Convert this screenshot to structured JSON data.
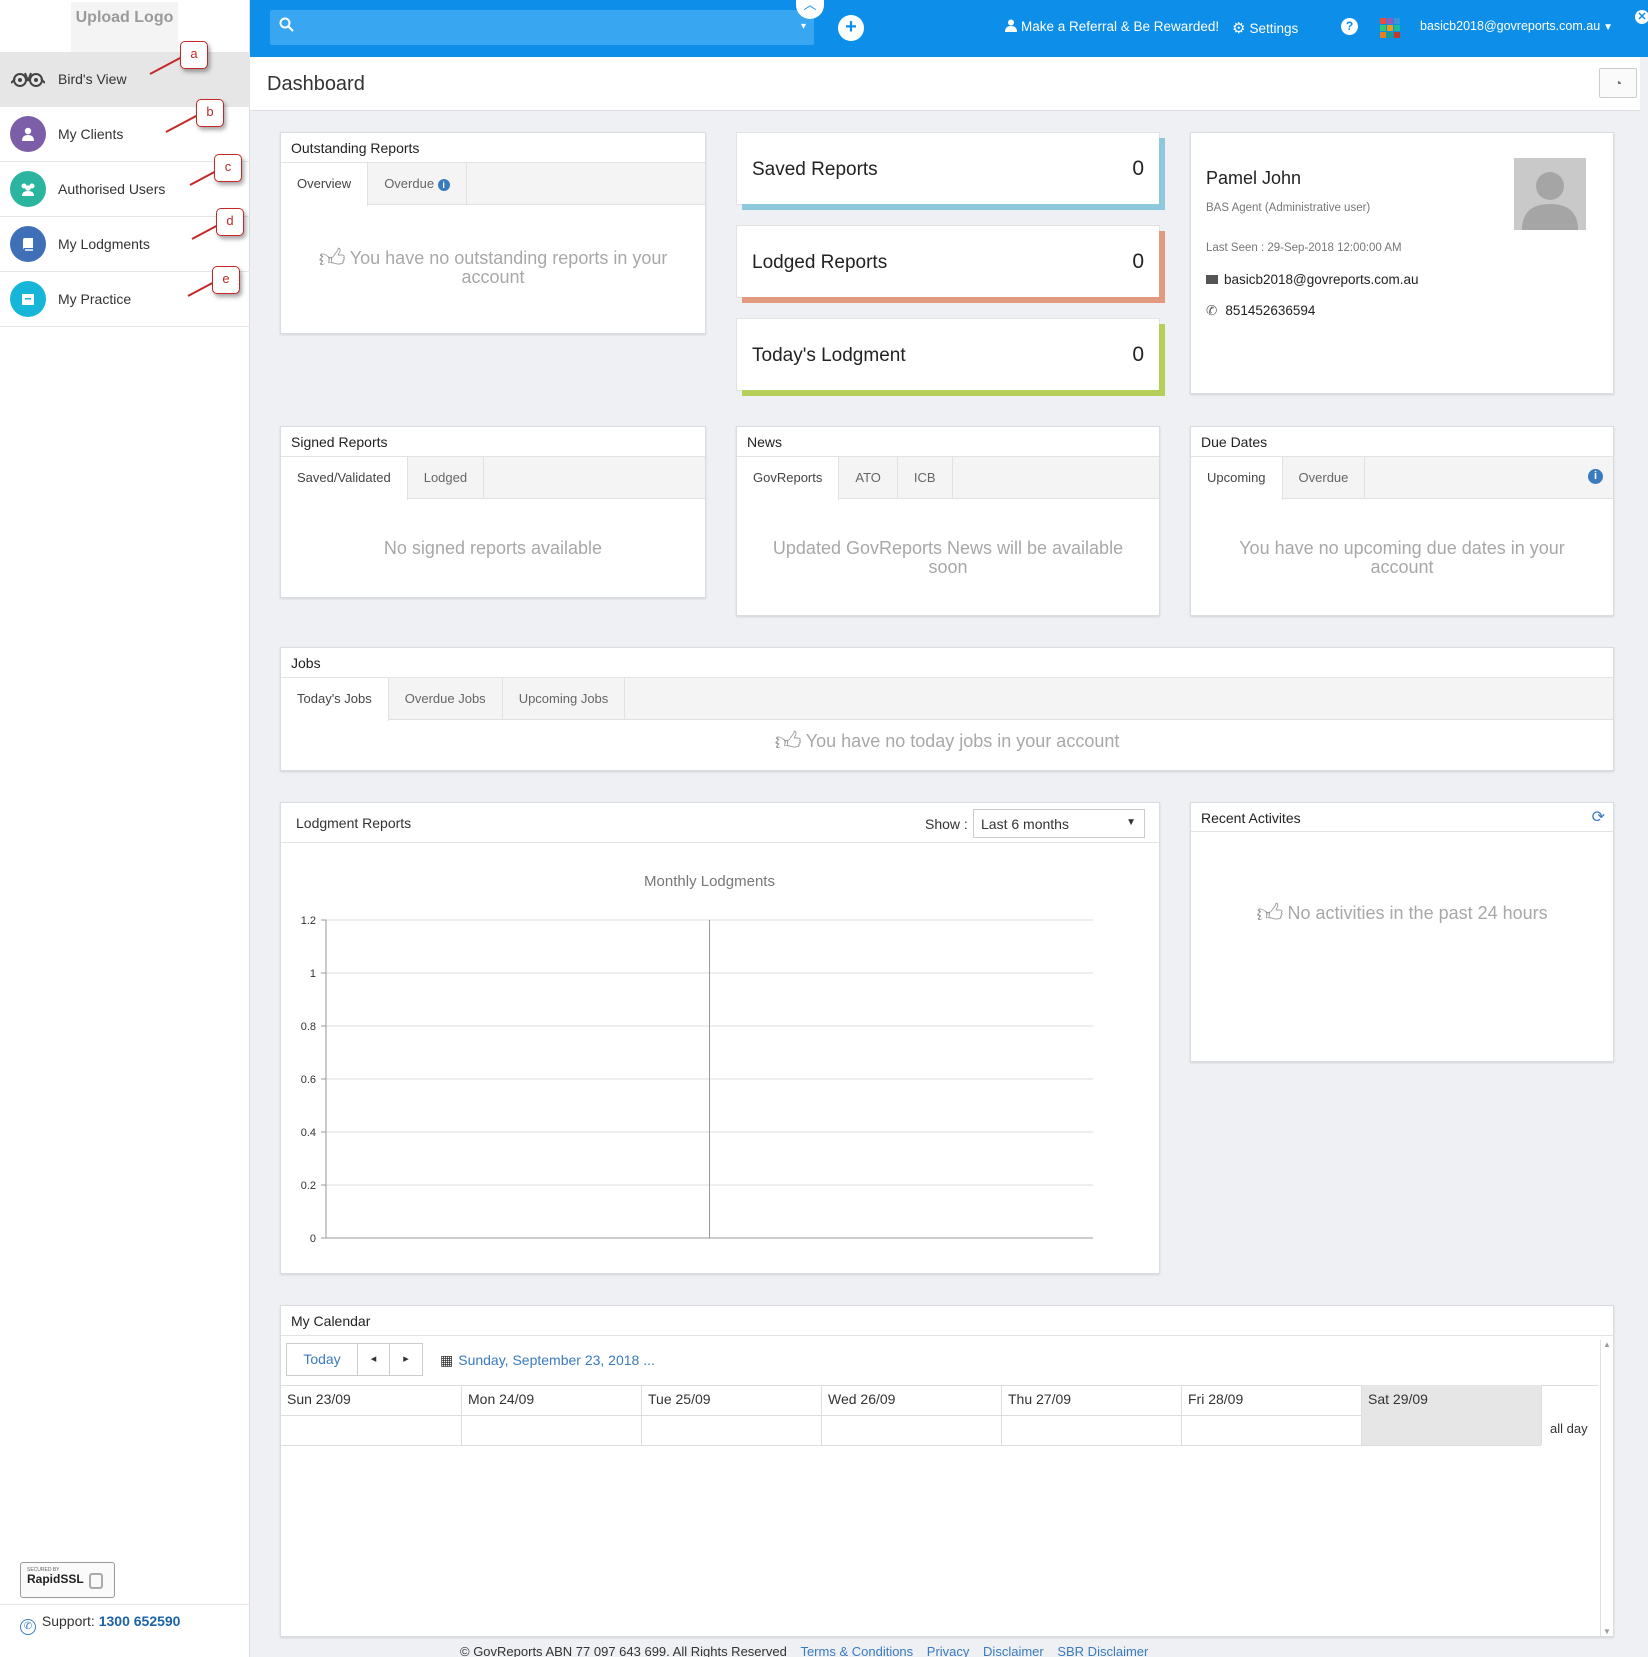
{
  "sidebar": {
    "logo_text": "Upload Logo",
    "items": [
      {
        "label": "Bird's View",
        "icon": "owl-icon",
        "color": "#555555",
        "callout": "a"
      },
      {
        "label": "My Clients",
        "icon": "user-icon",
        "color": "#7b5ea7",
        "callout": "b"
      },
      {
        "label": "Authorised Users",
        "icon": "users-icon",
        "color": "#2bb5a0",
        "callout": "c"
      },
      {
        "label": "My Lodgments",
        "icon": "book-icon",
        "color": "#3f6fb6",
        "callout": "d"
      },
      {
        "label": "My Practice",
        "icon": "briefcase-icon",
        "color": "#17b6d8",
        "callout": "e"
      }
    ],
    "ssl_top": "SECURED BY",
    "ssl_label": "RapidSSL",
    "support_label": "Support:",
    "support_phone": "1300 652590"
  },
  "topbar": {
    "referral": "Make a Referral & Be Rewarded!",
    "settings": "Settings",
    "user_email": "basicb2018@govreports.com.au",
    "help": "?"
  },
  "header": {
    "title": "Dashboard"
  },
  "outstanding": {
    "title": "Outstanding Reports",
    "tabs": [
      "Overview",
      "Overdue"
    ],
    "empty": "You have no outstanding reports in your account"
  },
  "stats": [
    {
      "label": "Saved Reports",
      "value": "0",
      "color": "#8ec8dc"
    },
    {
      "label": "Lodged Reports",
      "value": "0",
      "color": "#e29a7f"
    },
    {
      "label": "Today's Lodgment",
      "value": "0",
      "color": "#b5cf5a"
    }
  ],
  "profile": {
    "name": "Pamel John",
    "role": "BAS Agent (Administrative user)",
    "last_seen": "Last Seen : 29-Sep-2018 12:00:00 AM",
    "email": "basicb2018@govreports.com.au",
    "phone": "851452636594"
  },
  "signed": {
    "title": "Signed Reports",
    "tabs": [
      "Saved/Validated",
      "Lodged"
    ],
    "empty": "No signed reports available"
  },
  "news": {
    "title": "News",
    "tabs": [
      "GovReports",
      "ATO",
      "ICB"
    ],
    "empty": "Updated GovReports News will be available soon"
  },
  "due": {
    "title": "Due Dates",
    "tabs": [
      "Upcoming",
      "Overdue"
    ],
    "empty": "You have no upcoming due dates in your account"
  },
  "jobs": {
    "title": "Jobs",
    "tabs": [
      "Today's Jobs",
      "Overdue Jobs",
      "Upcoming Jobs"
    ],
    "empty": "You have no today jobs in your account"
  },
  "lodgment_reports": {
    "title": "Lodgment Reports",
    "show_label": "Show :",
    "selected": "Last 6 months"
  },
  "chart_data": {
    "type": "line",
    "title": "Monthly Lodgments",
    "xlabel": "",
    "ylabel": "",
    "ylim": [
      0,
      1.2
    ],
    "yticks": [
      "1.2",
      "1",
      "0.8",
      "0.6",
      "0.4",
      "0.2",
      "0"
    ],
    "series": [],
    "grid": true
  },
  "activities": {
    "title": "Recent Activites",
    "empty": "No activities in the past 24 hours"
  },
  "calendar": {
    "title": "My Calendar",
    "today": "Today",
    "prev": "◂",
    "next": "▸",
    "date_label": "Sunday, September 23, 2018 ...",
    "days": [
      "Sun 23/09",
      "Mon 24/09",
      "Tue 25/09",
      "Wed 26/09",
      "Thu 27/09",
      "Fri 28/09",
      "Sat 29/09"
    ],
    "all_day": "all day"
  },
  "footer": {
    "copyright": "© GovReports ABN 77 097 643 699. All Rights Reserved",
    "links": [
      "Terms & Conditions",
      "Privacy",
      "Disclaimer",
      "SBR Disclaimer"
    ]
  }
}
